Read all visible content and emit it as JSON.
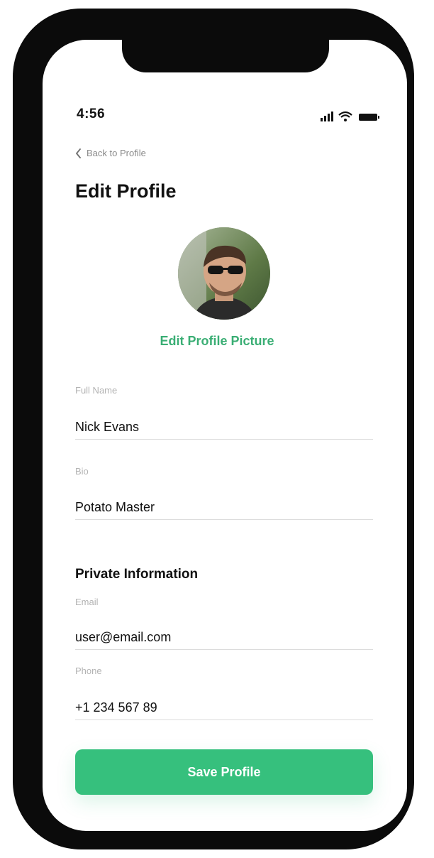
{
  "status_bar": {
    "time": "4:56",
    "icons": [
      "signal-icon",
      "wifi-icon",
      "battery-icon"
    ]
  },
  "nav": {
    "back_label": "Back to Profile",
    "back_icon": "chevron-left-icon"
  },
  "page": {
    "title": "Edit Profile"
  },
  "profile_picture": {
    "edit_label": "Edit Profile Picture"
  },
  "public_fields": {
    "full_name": {
      "label": "Full Name",
      "value": "Nick Evans"
    },
    "bio": {
      "label": "Bio",
      "value": "Potato Master"
    }
  },
  "private_section": {
    "title": "Private Information",
    "email": {
      "label": "Email",
      "value": "user@email.com"
    },
    "phone": {
      "label": "Phone",
      "value": "+1 234 567 89"
    }
  },
  "actions": {
    "save_label": "Save Profile"
  },
  "colors": {
    "accent": "#36c07d",
    "accent_text": "#3aae74",
    "frame": "#0b0b0b",
    "label": "#b3b3b3"
  }
}
